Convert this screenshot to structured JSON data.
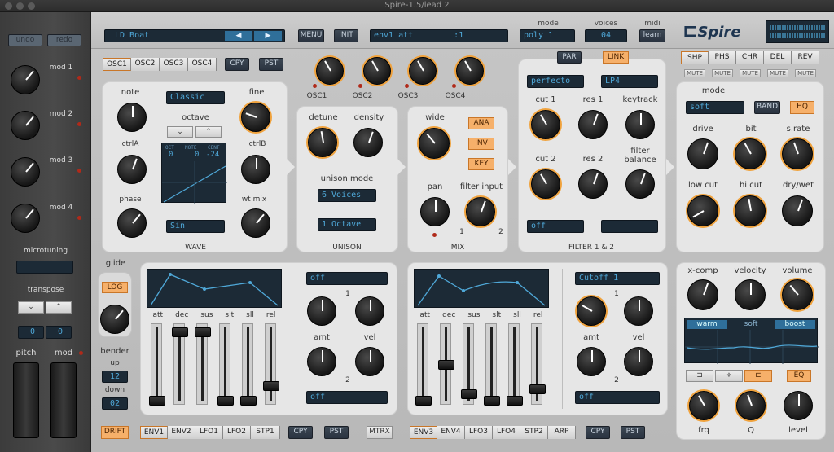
{
  "window": {
    "title": "Spire-1.5/lead 2"
  },
  "left": {
    "undo": "undo",
    "redo": "redo",
    "mods": [
      "mod 1",
      "mod 2",
      "mod 3",
      "mod 4"
    ],
    "microtuning": "microtuning",
    "transpose": "transpose",
    "transpose_values": [
      "0",
      "0"
    ],
    "pitch": "pitch",
    "mod": "mod"
  },
  "top": {
    "preset": "LD Boat",
    "menu": "MENU",
    "init": "INIT",
    "param": "env1 att",
    "param_val": ":1",
    "mode_label": "mode",
    "mode": "poly 1",
    "voices_label": "voices",
    "voices": "04",
    "midi_label": "midi",
    "midi": "learn",
    "logo": "Spire"
  },
  "osc": {
    "tabs": [
      "OSC1",
      "OSC2",
      "OSC3",
      "OSC4"
    ],
    "cpy": "CPY",
    "pst": "PST",
    "note": "note",
    "wavetype": "Classic",
    "fine": "fine",
    "octave": "octave",
    "ctrla": "ctrlA",
    "ctrlb": "ctrlB",
    "phase": "phase",
    "wtmix": "wt mix",
    "wave": "Sin",
    "wave_title": "WAVE",
    "oct_hdr": "OCT",
    "note_hdr": "NOTE",
    "cent_hdr": "CENT",
    "oct_val": "0",
    "note_val": "0",
    "cent_val": "-24"
  },
  "mixer": {
    "labels": [
      "OSC1",
      "OSC2",
      "OSC3",
      "OSC4"
    ]
  },
  "unison": {
    "detune": "detune",
    "density": "density",
    "mode_label": "unison mode",
    "voices": "6 Voices",
    "octave": "1 Octave",
    "title": "UNISON"
  },
  "mix": {
    "wide": "wide",
    "ana": "ANA",
    "inv": "INV",
    "key": "KEY",
    "pan": "pan",
    "filter_input": "filter input",
    "fi1": "1",
    "fi2": "2",
    "title": "MIX"
  },
  "filter": {
    "par": "PAR",
    "link": "LINK",
    "type1": "perfecto",
    "type2": "LP4",
    "cut1": "cut 1",
    "res1": "res 1",
    "keytrack": "keytrack",
    "cut2": "cut 2",
    "res2": "res 2",
    "balance": "filter\nbalance",
    "mode1": "off",
    "mode2": "",
    "title": "FILTER 1 & 2"
  },
  "fx": {
    "tabs": [
      "SHP",
      "PHS",
      "CHR",
      "DEL",
      "REV"
    ],
    "mute": "MUTE",
    "mode_label": "mode",
    "mode": "soft",
    "band": "BAND",
    "hq": "HQ",
    "drive": "drive",
    "bit": "bit",
    "srate": "s.rate",
    "lowcut": "low cut",
    "hicut": "hi cut",
    "drywet": "dry/wet"
  },
  "glide": {
    "glide": "glide",
    "log": "LOG",
    "bender": "bender",
    "up": "up",
    "up_val": "12",
    "down": "down",
    "down_val": "02"
  },
  "env1": {
    "labels": [
      "att",
      "dec",
      "sus",
      "slt",
      "sll",
      "rel"
    ],
    "dest1": "off",
    "dest2": "off",
    "n1": "1",
    "n2": "2",
    "amt": "amt",
    "vel": "vel",
    "amt2": "amt",
    "vel2": "vel"
  },
  "env2": {
    "labels": [
      "att",
      "dec",
      "sus",
      "slt",
      "sll",
      "rel"
    ],
    "dest1": "Cutoff 1",
    "dest2": "off",
    "n1": "1",
    "n2": "2",
    "amt": "amt",
    "vel": "vel",
    "amt2": "amt",
    "vel2": "vel"
  },
  "eq": {
    "xcomp": "x-comp",
    "velocity": "velocity",
    "volume": "volume",
    "warm": "warm",
    "soft": "soft",
    "boost": "boost",
    "eq": "EQ",
    "frq": "frq",
    "q": "Q",
    "level": "level"
  },
  "bottom": {
    "drift": "DRIFT",
    "tabs1": [
      "ENV1",
      "ENV2",
      "LFO1",
      "LFO2",
      "STP1"
    ],
    "cpy": "CPY",
    "pst": "PST",
    "mtrx": "MTRX",
    "tabs2": [
      "ENV3",
      "ENV4",
      "LFO3",
      "LFO4",
      "STP2",
      "ARP"
    ],
    "cpy2": "CPY",
    "pst2": "PST"
  },
  "colors": {
    "accent": "#f0a23c",
    "lcd": "#4fa8d8",
    "panel": "#e6e6e6"
  }
}
